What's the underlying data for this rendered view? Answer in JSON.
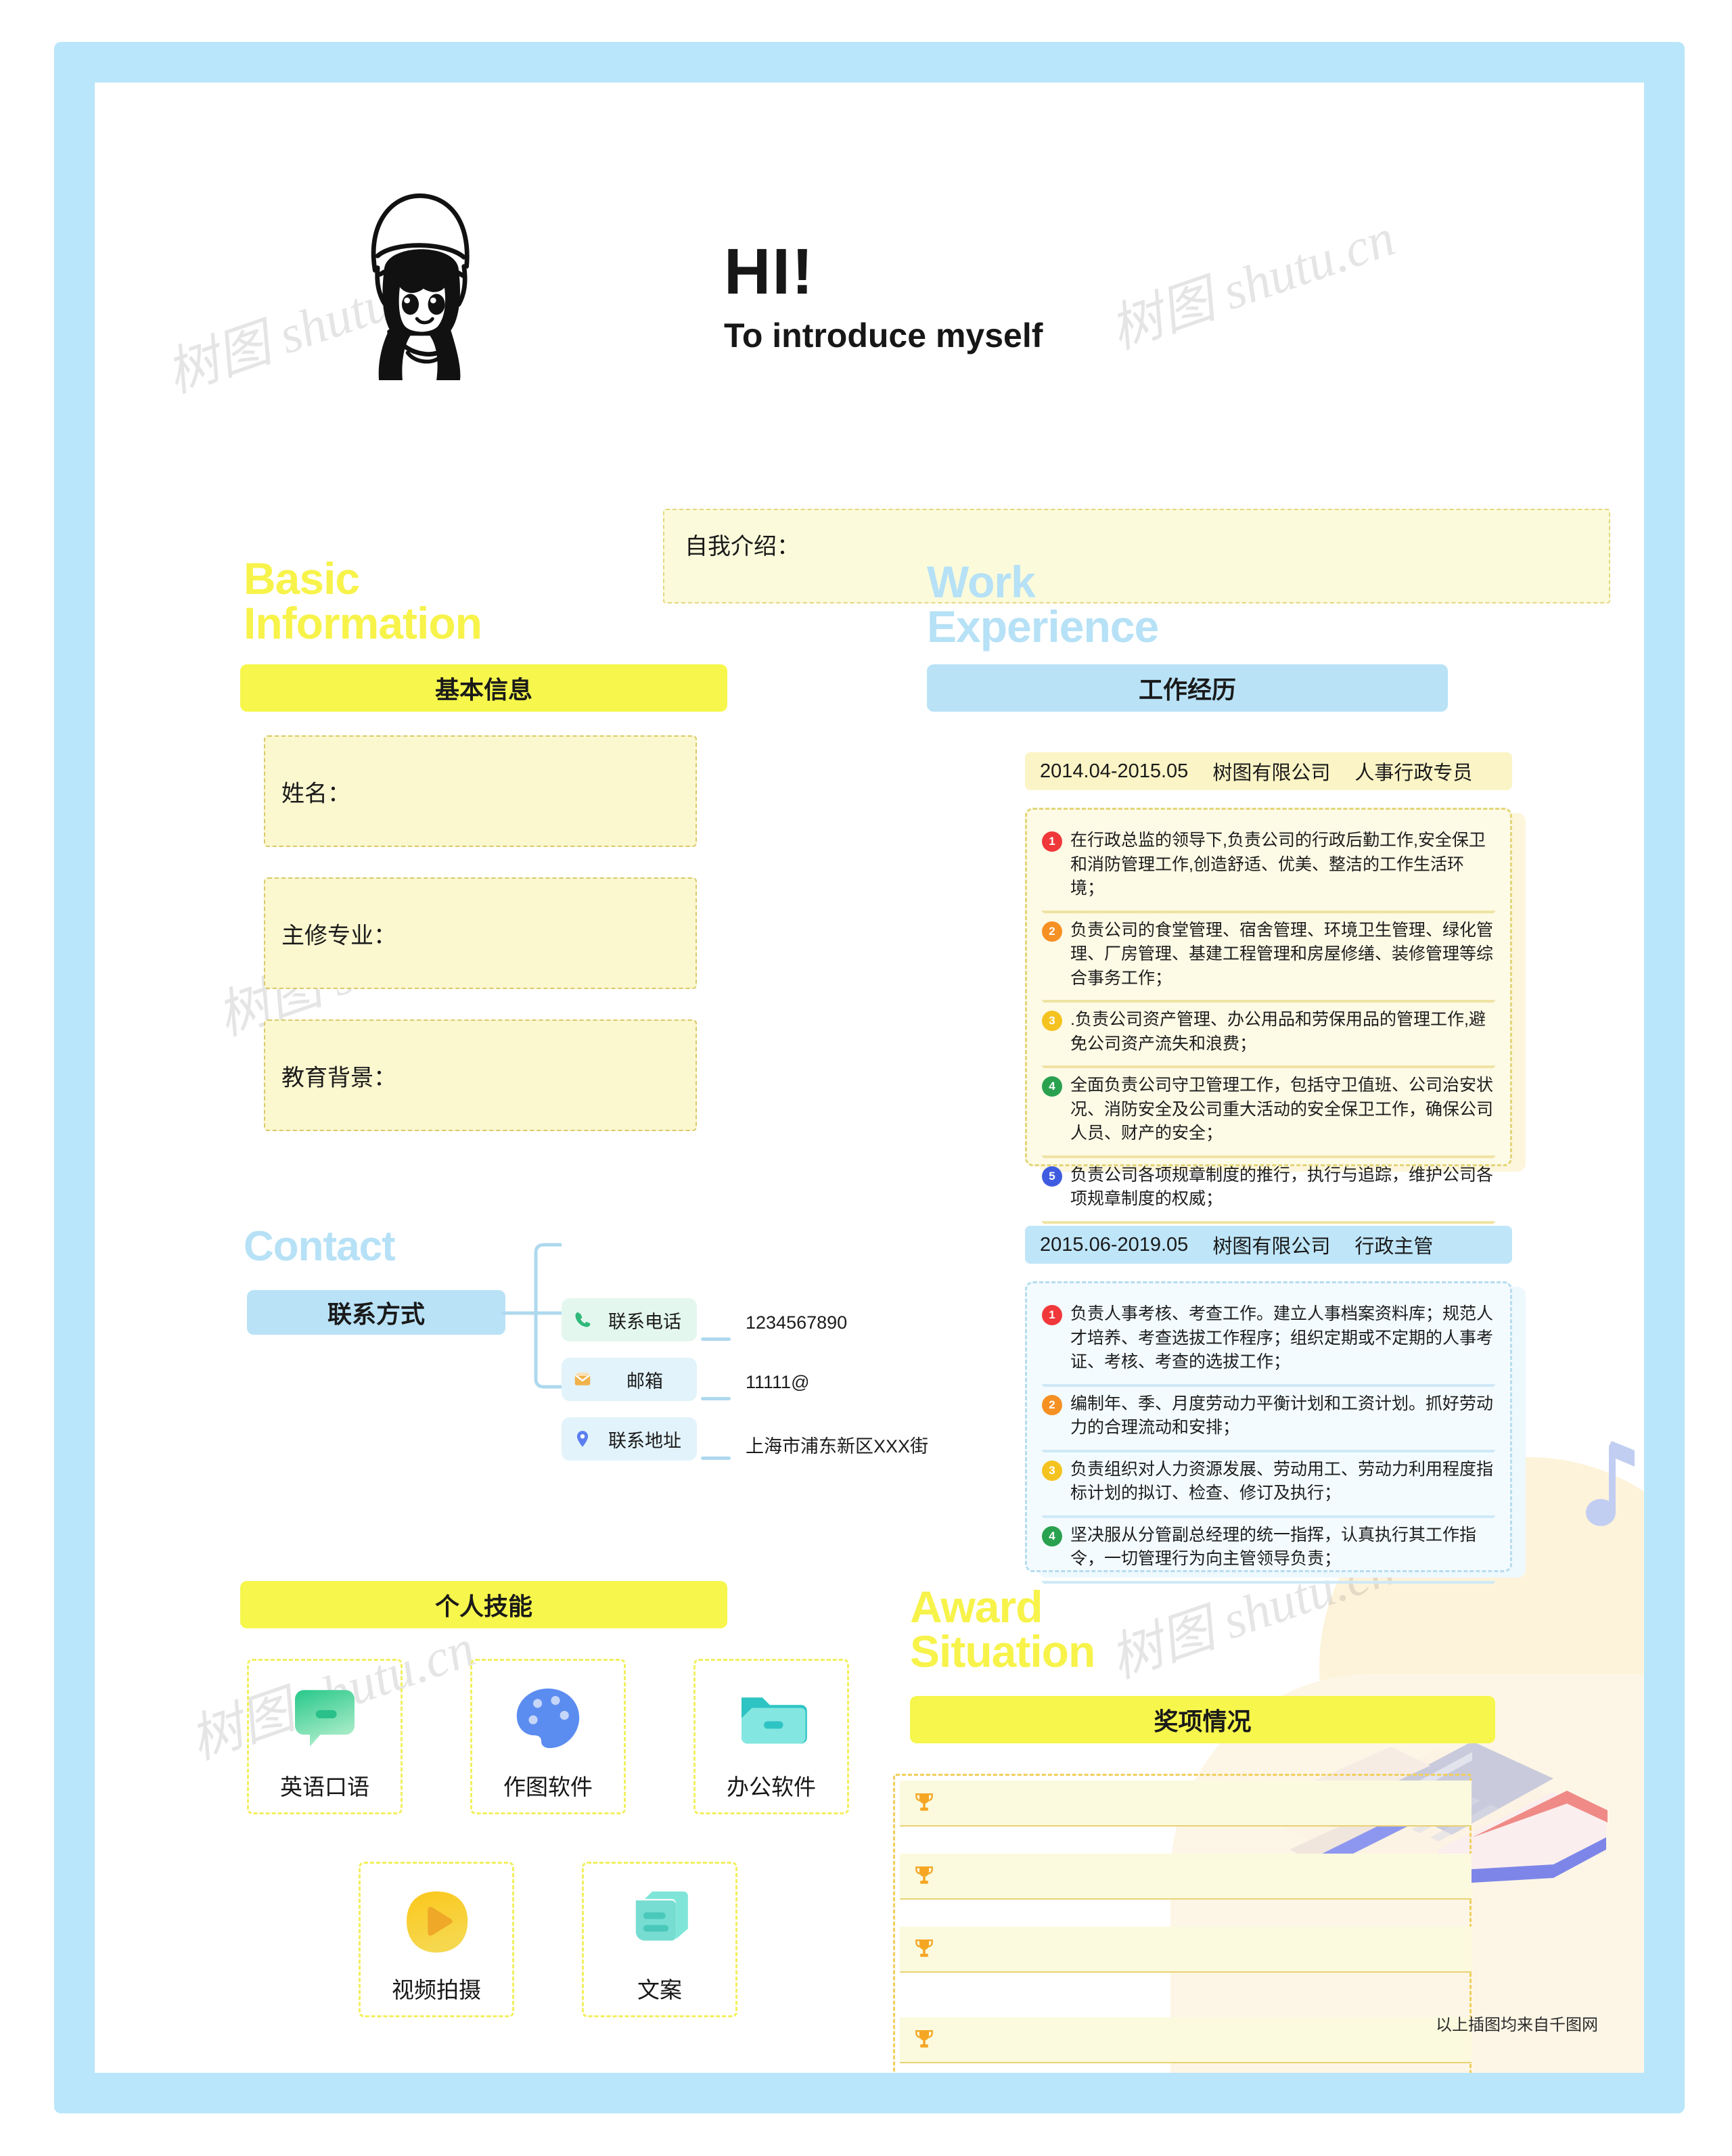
{
  "header": {
    "title": "HI!",
    "subtitle": "To introduce myself",
    "avatar_icon": "girl-avatar-illustration"
  },
  "intro": {
    "label": "自我介绍：",
    "value": "",
    "placeholder": ""
  },
  "basic": {
    "title_line1": "Basic",
    "title_line2": "Information",
    "bar_label": "基本信息",
    "fields": [
      {
        "label": "姓名：",
        "value": ""
      },
      {
        "label": "主修专业：",
        "value": ""
      },
      {
        "label": "教育背景：",
        "value": ""
      }
    ]
  },
  "contact": {
    "title": "Contact",
    "bar_label": "联系方式",
    "items": [
      {
        "icon": "phone-icon",
        "label": "联系电话",
        "value": "1234567890"
      },
      {
        "icon": "mail-icon",
        "label": "邮箱",
        "value": "11111@"
      },
      {
        "icon": "location-pin-icon",
        "label": "联系地址",
        "value": "上海市浦东新区XXX街"
      }
    ]
  },
  "skills": {
    "bar_label": "个人技能",
    "items": [
      {
        "icon": "speech-bubble-icon",
        "label": "英语口语"
      },
      {
        "icon": "palette-icon",
        "label": "作图软件"
      },
      {
        "icon": "folder-icon",
        "label": "办公软件"
      },
      {
        "icon": "play-button-icon",
        "label": "视频拍摄"
      },
      {
        "icon": "documents-icon",
        "label": "文案"
      }
    ]
  },
  "work": {
    "title_line1": "Work",
    "title_line2": "Experience",
    "bar_label": "工作经历",
    "jobs": [
      {
        "period": "2014.04-2015.05",
        "company": "树图有限公司",
        "role": "人事行政专员",
        "bullets": [
          {
            "num": "1",
            "color": "#f0383a",
            "text": "在行政总监的领导下,负责公司的行政后勤工作,安全保卫和消防管理工作,创造舒适、优美、整洁的工作生活环境；"
          },
          {
            "num": "2",
            "color": "#f59023",
            "text": "负责公司的食堂管理、宿舍管理、环境卫生管理、绿化管理、厂房管理、基建工程管理和房屋修缮、装修管理等综合事务工作；"
          },
          {
            "num": "3",
            "color": "#f4c320",
            "text": ".负责公司资产管理、办公用品和劳保用品的管理工作,避免公司资产流失和浪费；"
          },
          {
            "num": "4",
            "color": "#2aa14f",
            "text": "全面负责公司守卫管理工作，包括守卫值班、公司治安状况、消防安全及公司重大活动的安全保卫工作，确保公司人员、财产的安全；"
          },
          {
            "num": "5",
            "color": "#3f5ce0",
            "text": "负责公司各项规章制度的推行，执行与追踪，维护公司各项规章制度的权威；"
          }
        ]
      },
      {
        "period": "2015.06-2019.05",
        "company": "树图有限公司",
        "role": "行政主管",
        "bullets": [
          {
            "num": "1",
            "color": "#f0383a",
            "text": "负责人事考核、考查工作。建立人事档案资料库；规范人才培养、考查选拔工作程序；组织定期或不定期的人事考证、考核、考查的选拔工作；"
          },
          {
            "num": "2",
            "color": "#f59023",
            "text": "编制年、季、月度劳动力平衡计划和工资计划。抓好劳动力的合理流动和安排；"
          },
          {
            "num": "3",
            "color": "#f4c320",
            "text": "负责组织对人力资源发展、劳动用工、劳动力利用程度指标计划的拟订、检查、修订及执行；"
          },
          {
            "num": "4",
            "color": "#2aa14f",
            "text": "坚决服从分管副总经理的统一指挥，认真执行其工作指令，一切管理行为向主管领导负责；"
          }
        ]
      }
    ]
  },
  "award": {
    "title_line1": "Award",
    "title_line2": "Situation",
    "bar_label": "奖项情况",
    "rows": [
      {
        "icon": "trophy-icon",
        "value": ""
      },
      {
        "icon": "trophy-icon",
        "value": ""
      },
      {
        "icon": "trophy-icon",
        "value": ""
      },
      {
        "icon": "trophy-icon",
        "value": ""
      }
    ]
  },
  "footer": {
    "note": "以上插图均来自千图网"
  },
  "watermarks": [
    "树图 shutu.cn",
    "树图 shutu.cn",
    "树图 shutu.cn",
    "树图 shutu.cn",
    "树图 shutu.cn",
    "树图 shutu.cn"
  ],
  "colors": {
    "frame_blue": "#b9e6fa",
    "accent_yellow": "#f6f64c",
    "accent_blue": "#b9e2f7",
    "field_yellow": "#fbf7cf",
    "title_yellow": "#f7f34a",
    "title_blue": "#b6e1f6"
  }
}
